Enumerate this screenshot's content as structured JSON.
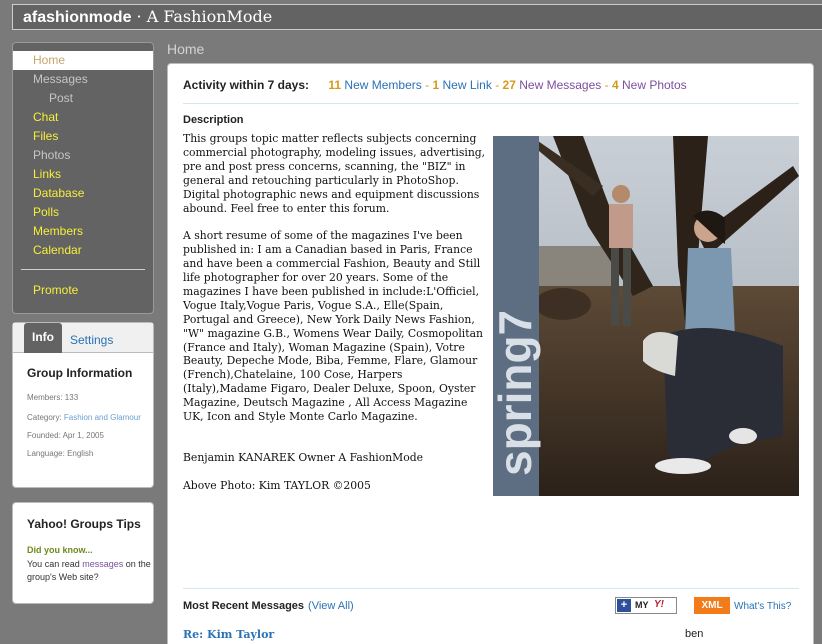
{
  "header": {
    "group_id": "afashionmode",
    "separator": " · ",
    "group_name": "A FashionMode"
  },
  "nav": {
    "items": [
      {
        "label": "Home"
      },
      {
        "label": "Messages"
      },
      {
        "label": "Post"
      },
      {
        "label": "Chat"
      },
      {
        "label": "Files"
      },
      {
        "label": "Photos"
      },
      {
        "label": "Links"
      },
      {
        "label": "Database"
      },
      {
        "label": "Polls"
      },
      {
        "label": "Members"
      },
      {
        "label": "Calendar"
      }
    ],
    "promote": "Promote"
  },
  "info_panel": {
    "tab_info": "Info",
    "tab_settings": "Settings",
    "title": "Group Information",
    "members_label": "Members:",
    "members_value": "133",
    "category_label": "Category:",
    "category_value": "Fashion and Glamour",
    "founded_label": "Founded:",
    "founded_value": "Apr 1, 2005",
    "language_label": "Language:",
    "language_value": "English"
  },
  "tips": {
    "title": "Yahoo! Groups Tips",
    "did_you_know": "Did you know...",
    "text_before": "You can read ",
    "link": "messages",
    "text_after": " on the group's Web site?"
  },
  "page": {
    "title": "Home"
  },
  "activity": {
    "label": "Activity within 7 days:",
    "members_count": "11",
    "members_text": "New Members",
    "links_count": "1",
    "links_text": "New Link",
    "messages_count": "27",
    "messages_text": "New Messages",
    "photos_count": "4",
    "photos_text": "New Photos",
    "dash": "-"
  },
  "description": {
    "heading": "Description",
    "p1": "This groups topic matter reflects subjects concerning commercial photography, modeling issues, advertising, pre and post press concerns, scanning, the \"BIZ\" in general and retouching particularly in PhotoShop. Digital photographic news and equipment discussions abound. Feel free to enter this forum.",
    "p2": "A short resume of some of the magazines I've been published in: I am a Canadian based in Paris, France and have been a commercial Fashion, Beauty and Still life photographer for over 20 years. Some of the magazines I have been published in include:L'Officiel, Vogue Italy,Vogue Paris, Vogue S.A., Elle(Spain, Portugal and Greece), New York Daily News Fashion, \"W\" magazine G.B., Womens Wear Daily, Cosmopolitan (France and Italy), Woman Magazine (Spain), Votre Beauty, Depeche Mode, Biba, Femme, Flare, Glamour (French),Chatelaine, 100 Cose, Harpers (Italy),Madame Figaro, Dealer Deluxe, Spoon, Oyster Magazine, Deutsch Magazine , All Access Magazine UK, Icon and Style Monte Carlo Magazine.",
    "owner": "Benjamin KANAREK Owner A FashionMode",
    "photo_credit": "Above Photo: Kim TAYLOR ©2005",
    "photo_text": "spring7"
  },
  "messages": {
    "heading": "Most Recent Messages",
    "view_all": "(View All)",
    "my_label": "MY",
    "yahoo_label": "Y!",
    "xml_label": "XML",
    "whats_this": "What's This?",
    "latest_title": "Re: Kim Taylor",
    "latest_author": "ben"
  }
}
